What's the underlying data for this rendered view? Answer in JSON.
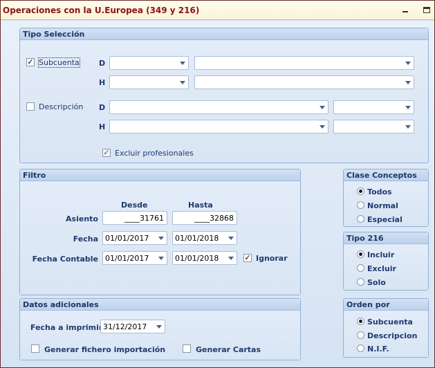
{
  "window": {
    "title": "Operaciones con la U.Europea (349 y 216)"
  },
  "tipo_seleccion": {
    "heading": "Tipo Selección",
    "subcuenta_label": "Subcuenta",
    "descripcion_label": "Descripción",
    "d_label": "D",
    "h_label": "H",
    "excluir_label": "Excluir profesionales"
  },
  "filtro": {
    "heading": "Filtro",
    "desde_label": "Desde",
    "hasta_label": "Hasta",
    "asiento_label": "Asiento",
    "asiento_desde": "____31761",
    "asiento_hasta": "____32868",
    "fecha_label": "Fecha",
    "fecha_desde": "01/01/2017",
    "fecha_hasta": "01/01/2018",
    "fecha_contable_label": "Fecha Contable",
    "fecha_contable_desde": "01/01/2017",
    "fecha_contable_hasta": "01/01/2018",
    "ignorar_label": "Ignorar"
  },
  "datos_adicionales": {
    "heading": "Datos adicionales",
    "fecha_imprimir_label": "Fecha a imprimir",
    "fecha_imprimir_value": "31/12/2017",
    "generar_fichero_label": "Generar fichero importación",
    "generar_cartas_label": "Generar Cartas"
  },
  "clase_conceptos": {
    "heading": "Clase Conceptos",
    "options": [
      "Todos",
      "Normal",
      "Especial"
    ],
    "selected": "Todos"
  },
  "tipo_216": {
    "heading": "Tipo 216",
    "options": [
      "Incluir",
      "Excluir",
      "Solo"
    ],
    "selected": "Incluir"
  },
  "orden_por": {
    "heading": "Orden por",
    "options": [
      "Subcuenta",
      "Descripcion",
      "N.I.F."
    ],
    "selected": "Subcuenta"
  },
  "icons": [
    "minimize-icon",
    "maximize-icon",
    "chevron-down-icon",
    "checkmark-icon"
  ]
}
